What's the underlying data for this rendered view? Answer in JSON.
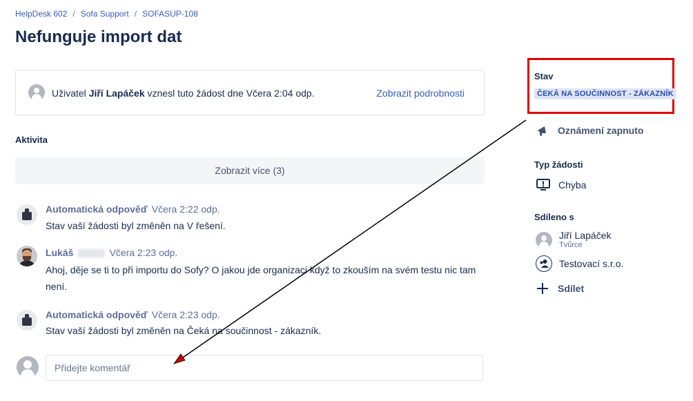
{
  "breadcrumb": {
    "items": [
      "HelpDesk 602",
      "Sofa Support",
      "SOFASUP-108"
    ],
    "separator": "/"
  },
  "page": {
    "title": "Nefunguje import dat"
  },
  "request": {
    "prefix": "Uživatel ",
    "user": "Jiří Lapáček",
    "suffix": " vznesl tuto žádost dne Včera 2:04 odp.",
    "details_link": "Zobrazit podrobnosti"
  },
  "activity": {
    "label": "Aktivita",
    "show_more": "Zobrazit více (3)",
    "items": [
      {
        "author": "Automatická odpověď",
        "time": "Včera 2:22 odp.",
        "message": "Stav vaší žádosti byl změněn na V řešení."
      },
      {
        "author": "Lukáš",
        "time": "Včera 2:23 odp.",
        "message_line1": "Ahoj, děje se ti to při importu do Sofy? O jakou jde organizaci když to zkouším na svém testu nic tam",
        "message_line2": "není."
      },
      {
        "author": "Automatická odpověď",
        "time": "Včera 2:23 odp.",
        "message": "Stav vaší žádosti byl změněn na Čeká na součinnost - zákazník."
      }
    ],
    "comment_placeholder": "Přidejte komentář"
  },
  "sidebar": {
    "status_label": "Stav",
    "status_value": "ČEKÁ NA SOUČINNOST - ZÁKAZNÍK",
    "notifications": "Oznámení zapnuto",
    "request_type_label": "Typ žádosti",
    "request_type_value": "Chyba",
    "shared_label": "Sdíleno s",
    "shared": [
      {
        "name": "Jiří Lapáček",
        "role": "Tvůrce"
      },
      {
        "name": "Testovací s.r.o."
      }
    ],
    "share_button": "Sdílet"
  },
  "colors": {
    "link": "#3b5bbf",
    "status_bg": "#dde4f7",
    "status_text": "#2b4bab",
    "highlight_border": "#e00000"
  }
}
